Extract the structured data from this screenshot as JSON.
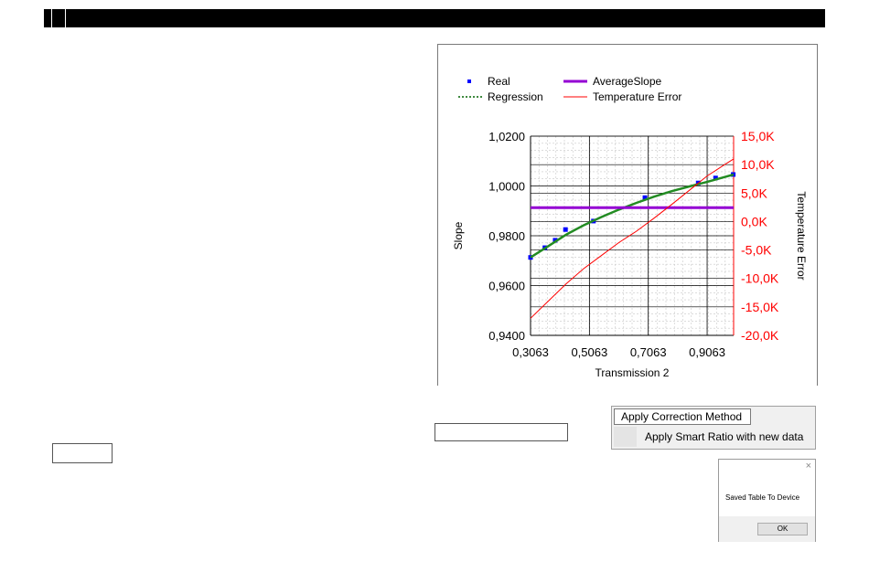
{
  "chart_data": {
    "type": "scatter",
    "title": "",
    "xlabel": "Transmission 2",
    "ylabel": "Slope",
    "y2label": "Temperature Error",
    "x_ticks": [
      "0,3063",
      "0,5063",
      "0,7063",
      "0,9063"
    ],
    "y_ticks": [
      "0,9400",
      "0,9600",
      "0,9800",
      "1,0000",
      "1,0200"
    ],
    "y2_ticks": [
      "-20,0K",
      "-15,0K",
      "-10,0K",
      "-5,0K",
      "0,0K",
      "5,0K",
      "10,0K",
      "15,0K"
    ],
    "xlim": [
      0.3063,
      0.9963
    ],
    "ylim": [
      0.94,
      1.02
    ],
    "y2lim": [
      -20,
      15
    ],
    "grid": true,
    "legend": [
      {
        "label": "Real",
        "color": "#0000ff",
        "style": "marker"
      },
      {
        "label": "AverageSlope",
        "color": "#9400d3",
        "style": "line"
      },
      {
        "label": "Regression",
        "color": "#006400",
        "style": "dotted"
      },
      {
        "label": "Temperature Error",
        "color": "#ff0000",
        "style": "line"
      }
    ],
    "legend_position": "top",
    "series": [
      {
        "name": "Real",
        "color": "#0000ff",
        "x": [
          0.3063,
          0.355,
          0.39,
          0.425,
          0.52,
          0.695,
          0.876,
          0.935,
          0.995
        ],
        "y": [
          0.9713,
          0.9752,
          0.9782,
          0.9825,
          0.9859,
          0.9953,
          1.0012,
          1.0032,
          1.0046
        ]
      },
      {
        "name": "Regression",
        "color": "#228b22",
        "x": [
          0.3063,
          0.3663,
          0.4263,
          0.4863,
          0.5463,
          0.6063,
          0.6663,
          0.7263,
          0.7863,
          0.8463,
          0.9063,
          0.9663,
          0.9963
        ],
        "y": [
          0.9713,
          0.9758,
          0.9804,
          0.9842,
          0.9875,
          0.9905,
          0.9932,
          0.9957,
          0.9979,
          0.9998,
          1.0016,
          1.0036,
          1.0046
        ]
      },
      {
        "name": "AverageSlope",
        "color": "#9400d3",
        "x": [
          0.3063,
          0.9963
        ],
        "y": [
          0.9913,
          0.9913
        ]
      },
      {
        "name": "Temperature Error",
        "color": "#ff0000",
        "axis": "right",
        "x": [
          0.3063,
          0.3663,
          0.4263,
          0.4863,
          0.5463,
          0.6063,
          0.6663,
          0.7263,
          0.7863,
          0.8463,
          0.9063,
          0.9663,
          0.9963
        ],
        "y": [
          -17,
          -14,
          -11,
          -8.3,
          -6,
          -3.7,
          -1.7,
          0.6,
          3,
          5.5,
          8,
          10,
          11
        ]
      }
    ]
  },
  "menu": {
    "header": "Apply Correction Method",
    "item": "Apply Smart Ratio with new data"
  },
  "dialog": {
    "close": "×",
    "message": "Saved Table To Device",
    "ok_label": "OK"
  }
}
